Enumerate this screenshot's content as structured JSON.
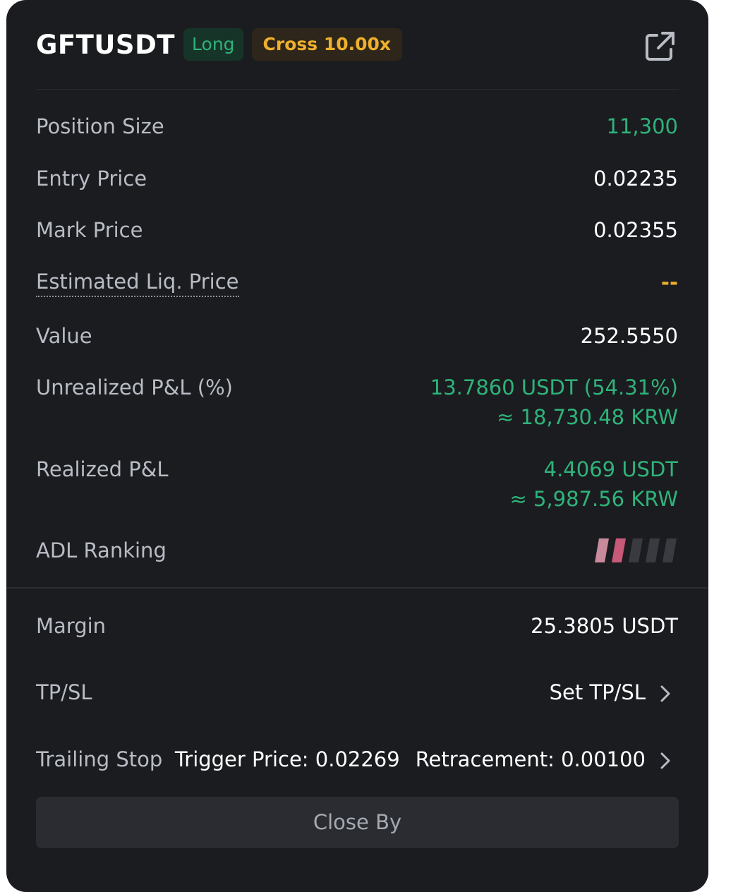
{
  "header": {
    "symbol": "GFTUSDT",
    "side_badge": "Long",
    "margin_badge": "Cross 10.00x",
    "share_icon": "external-link-icon"
  },
  "rows": {
    "position_size": {
      "label": "Position Size",
      "value": "11,300"
    },
    "entry_price": {
      "label": "Entry Price",
      "value": "0.02235"
    },
    "mark_price": {
      "label": "Mark Price",
      "value": "0.02355"
    },
    "liq_price": {
      "label": "Estimated Liq. Price",
      "value": "--"
    },
    "value": {
      "label": "Value",
      "value": "252.5550"
    },
    "unrealized_pnl": {
      "label": "Unrealized P&L (%)",
      "value": "13.7860 USDT (54.31%)",
      "value_krw": "≈ 18,730.48 KRW"
    },
    "realized_pnl": {
      "label": "Realized P&L",
      "value": "4.4069 USDT",
      "value_krw": "≈ 5,987.56 KRW"
    },
    "adl_ranking": {
      "label": "ADL Ranking",
      "level": 2,
      "max": 5
    },
    "margin": {
      "label": "Margin",
      "value": "25.3805 USDT"
    },
    "tpsl": {
      "label": "TP/SL",
      "value": "Set TP/SL"
    },
    "trailing_stop": {
      "label": "Trailing Stop",
      "trigger": "Trigger Price: 0.02269",
      "retracement": "Retracement: 0.00100"
    }
  },
  "close_by": {
    "label": "Close By"
  },
  "colors": {
    "green": "#2fb37a",
    "orange": "#eeb02c",
    "adl_active_1": "#c98a9c",
    "adl_active_2": "#c75a78",
    "adl_inactive": "#3a3b41"
  }
}
